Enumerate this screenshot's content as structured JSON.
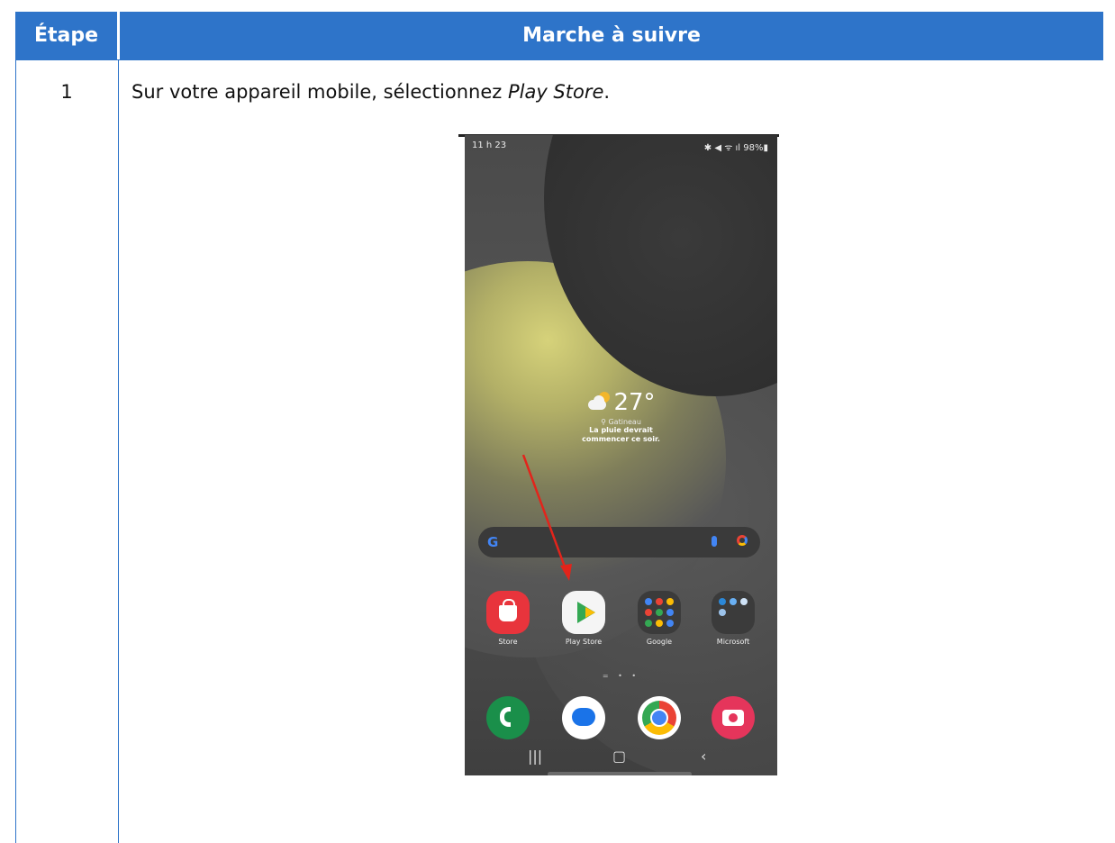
{
  "table": {
    "header_step": "Étape",
    "header_procedure": "Marche à suivre",
    "header_color": "#2e74c9"
  },
  "rows": [
    {
      "step": "1",
      "instruction_prefix": "Sur votre appareil mobile, sélectionnez ",
      "instruction_emphasis": "Play Store",
      "instruction_suffix": "."
    }
  ],
  "phone": {
    "status_time": "11 h 23",
    "status_icons": "✱ ◀ ᯤ ıl 98%▮",
    "weather": {
      "temperature": "27°",
      "city": "⚲ Gatineau",
      "forecast_line1": "La pluie devrait",
      "forecast_line2": "commencer ce soir."
    },
    "search_logo": "G",
    "apps": {
      "store": "Store",
      "play_store": "Play Store",
      "google": "Google",
      "microsoft": "Microsoft"
    },
    "page_indicator": "= • •",
    "nav": {
      "recents": "|||",
      "home": "▢",
      "back": "‹"
    }
  },
  "annotation_color": "#e3241b"
}
